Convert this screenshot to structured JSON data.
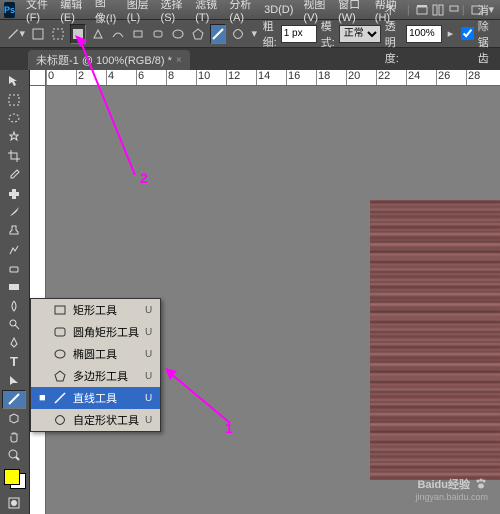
{
  "menubar": {
    "logo": "Ps",
    "items": [
      "文件(F)",
      "编辑(E)",
      "图像(I)",
      "图层(L)",
      "选择(S)",
      "滤镜(T)",
      "分析(A)",
      "3D(D)",
      "视图(V)",
      "窗口(W)",
      "帮助(H)"
    ]
  },
  "options": {
    "feather_label": "粗细:",
    "feather_value": "1 px",
    "mode_label": "模式:",
    "mode_value": "正常",
    "opacity_label": "不透明度:",
    "opacity_value": "100%",
    "antialias_label": "消除锯齿"
  },
  "tab": {
    "title": "未标题-1 @ 100%(RGB/8) *",
    "close": "×"
  },
  "ruler_marks": [
    "0",
    "2",
    "4",
    "6",
    "8",
    "10",
    "12",
    "14",
    "16",
    "18",
    "20",
    "22",
    "24",
    "26",
    "28"
  ],
  "flyout": {
    "items": [
      {
        "icon": "rect",
        "label": "矩形工具",
        "key": "U"
      },
      {
        "icon": "rrect",
        "label": "圆角矩形工具",
        "key": "U"
      },
      {
        "icon": "ellipse",
        "label": "椭圆工具",
        "key": "U"
      },
      {
        "icon": "polygon",
        "label": "多边形工具",
        "key": "U"
      },
      {
        "icon": "line",
        "label": "直线工具",
        "key": "U",
        "highlighted": true
      },
      {
        "icon": "custom",
        "label": "自定形状工具",
        "key": "U"
      }
    ]
  },
  "annotations": {
    "label1": "1",
    "label2": "2"
  },
  "watermark": {
    "brand": "Baidu经验",
    "byline": "jingyan.baidu.com"
  }
}
